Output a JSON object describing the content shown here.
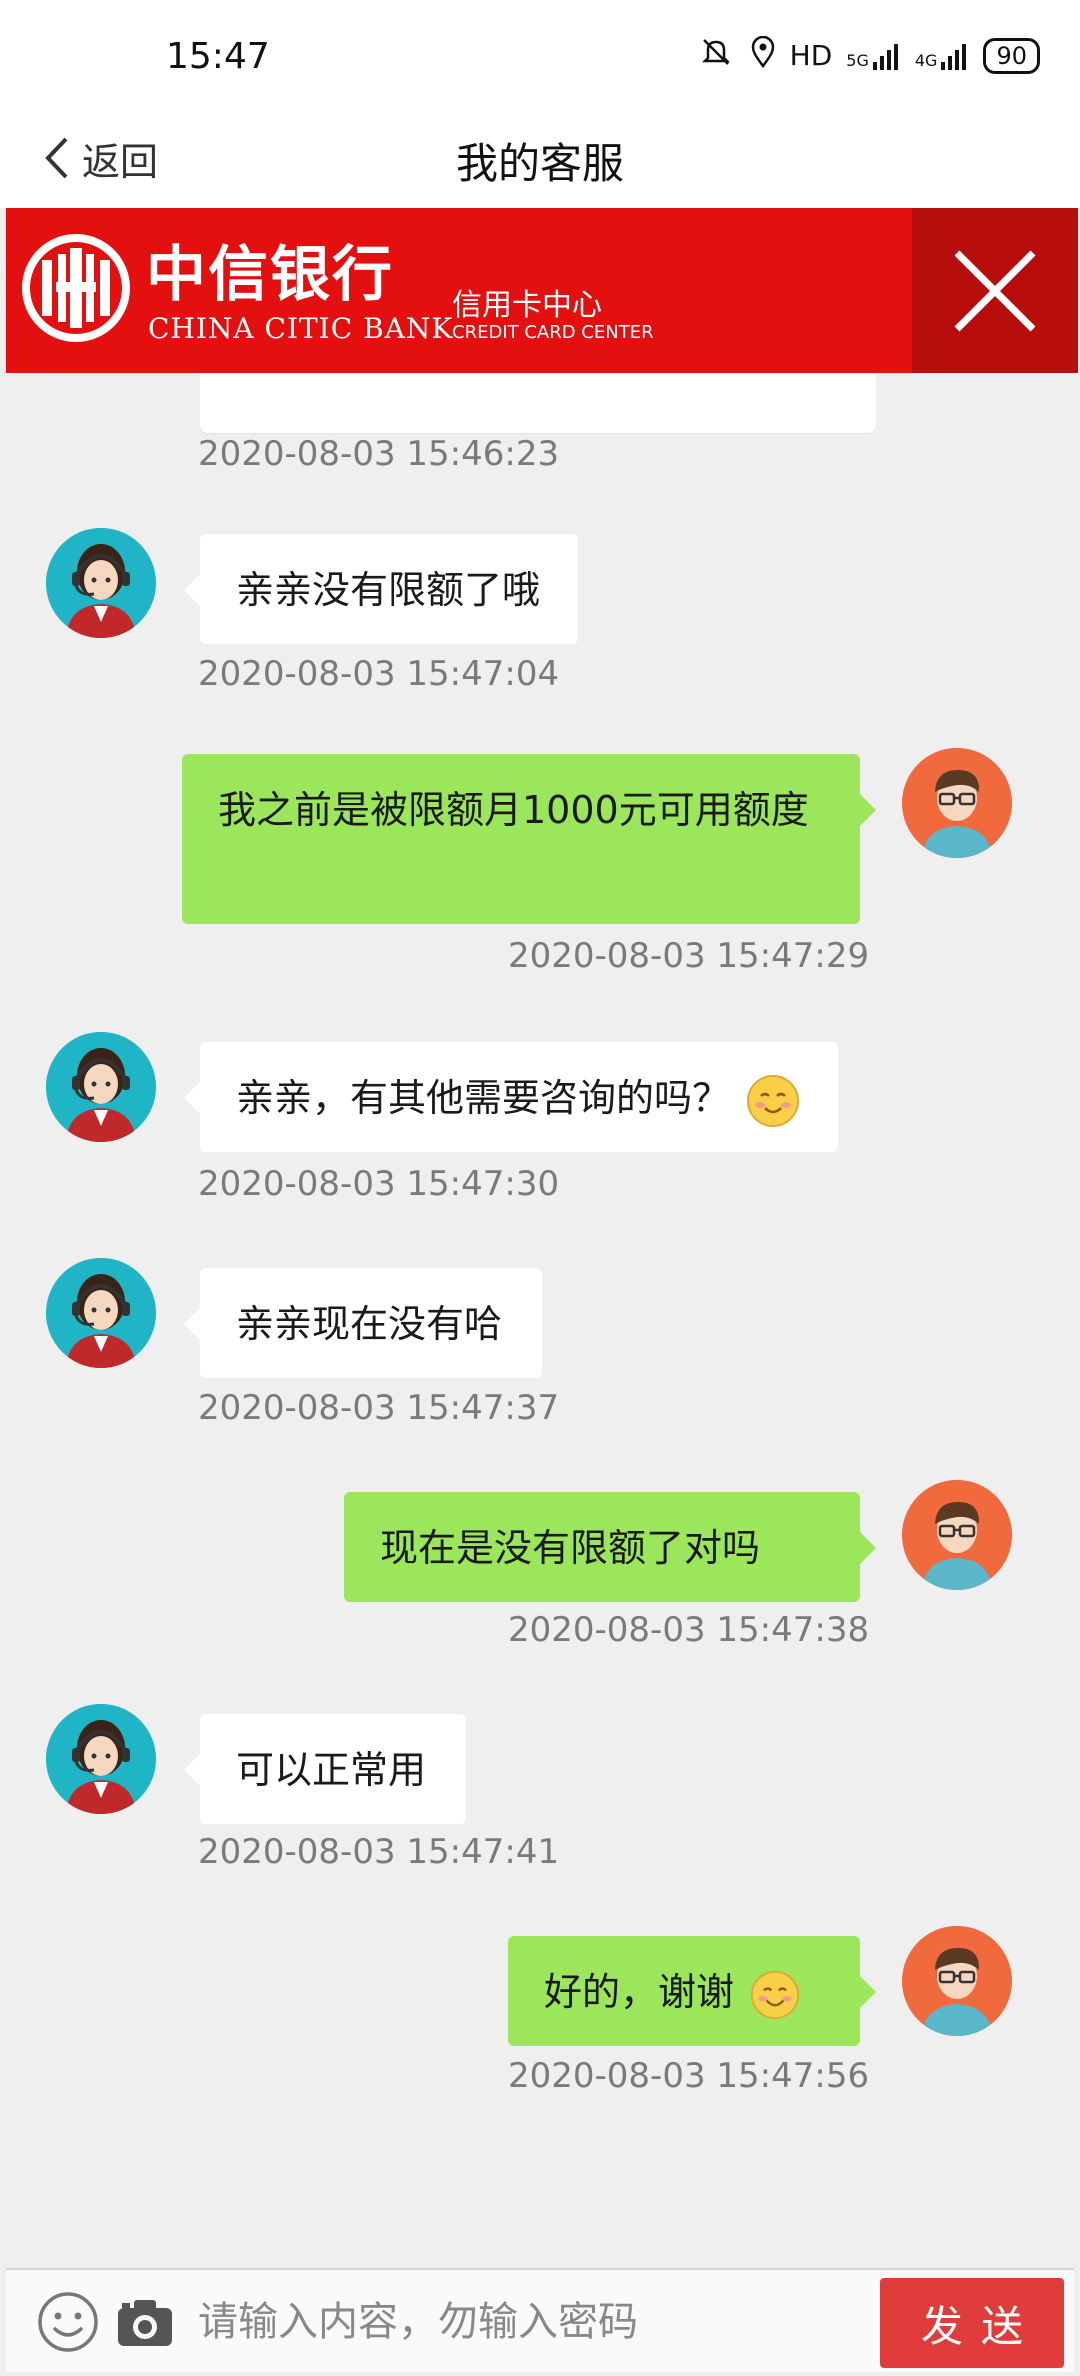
{
  "status_bar": {
    "time": "15:47",
    "network_label": "HD",
    "signal_5g": "5G",
    "signal_4g": "4G",
    "battery": "90"
  },
  "nav": {
    "back_label": "返回",
    "title": "我的客服"
  },
  "banner": {
    "bank_name_cn": "中信银行",
    "bank_name_en": "CHINA CITIC BANK",
    "center_cn": "信用卡中心",
    "center_en": "CREDIT CARD CENTER"
  },
  "chat": {
    "partial_timestamp": "2020-08-03 15:46:23",
    "messages": [
      {
        "sender": "agent",
        "text": "亲亲没有限额了哦",
        "timestamp": "2020-08-03 15:47:04"
      },
      {
        "sender": "user",
        "text": "我之前是被限额月1000元可用额度",
        "timestamp": "2020-08-03 15:47:29"
      },
      {
        "sender": "agent",
        "text": "亲亲，有其他需要咨询的吗？",
        "emoji": "blush-emoji",
        "timestamp": "2020-08-03 15:47:30"
      },
      {
        "sender": "agent",
        "text": "亲亲现在没有哈",
        "timestamp": "2020-08-03 15:47:37"
      },
      {
        "sender": "user",
        "text": "现在是没有限额了对吗",
        "timestamp": "2020-08-03 15:47:38"
      },
      {
        "sender": "agent",
        "text": "可以正常用",
        "timestamp": "2020-08-03 15:47:41"
      },
      {
        "sender": "user",
        "text": "好的，谢谢",
        "emoji": "smile-emoji",
        "timestamp": "2020-08-03 15:47:56"
      }
    ]
  },
  "input_bar": {
    "placeholder": "请输入内容，勿输入密码",
    "send_label": "发送"
  },
  "colors": {
    "banner_red": "#e40f0f",
    "user_bubble": "#9ce65c",
    "agent_avatar": "#1fb5c6",
    "user_avatar": "#f06a3e",
    "send_button": "#e03c3c"
  }
}
